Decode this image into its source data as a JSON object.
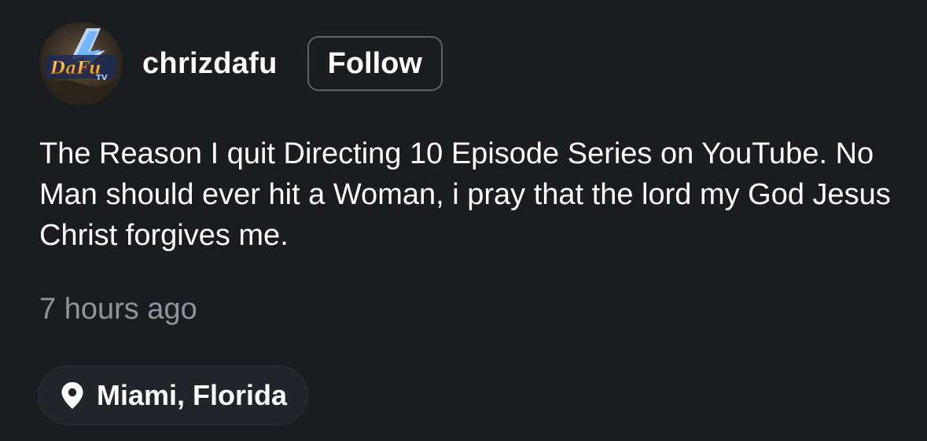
{
  "post": {
    "author": {
      "username": "chrizdafu",
      "avatar_icon": "avatar-logo-icon",
      "avatar_logo_text": "DaFu TV"
    },
    "follow_label": "Follow",
    "text": "The Reason I quit Directing 10 Episode Series on YouTube. No Man should ever hit a Woman, i pray that the lord my God Jesus Christ forgives me.",
    "timestamp": "7 hours ago",
    "location": {
      "icon": "map-pin-icon",
      "label": "Miami, Florida"
    }
  },
  "colors": {
    "background": "#1a1c1f",
    "text_primary": "#ffffff",
    "text_secondary": "#8f949a",
    "follow_border": "#5d6166",
    "chip_background": "#212428"
  }
}
